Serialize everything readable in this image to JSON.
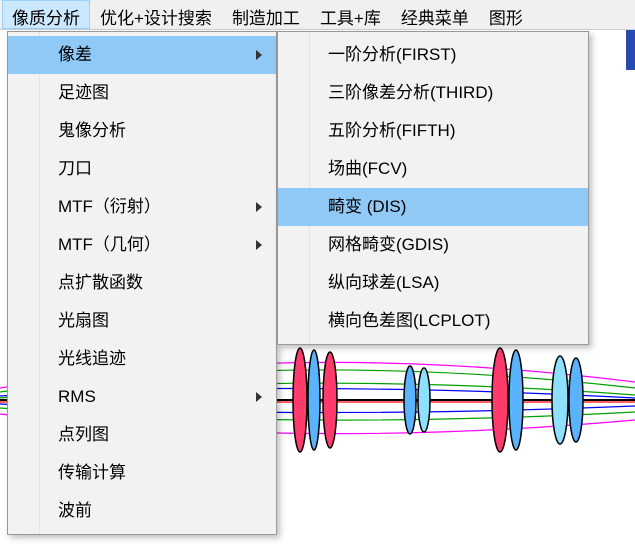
{
  "menubar": {
    "items": [
      {
        "label": "像质分析",
        "active": true
      },
      {
        "label": "优化+设计搜索",
        "active": false
      },
      {
        "label": "制造加工",
        "active": false
      },
      {
        "label": "工具+库",
        "active": false
      },
      {
        "label": "经典菜单",
        "active": false
      },
      {
        "label": "图形",
        "active": false
      }
    ]
  },
  "primary_menu": {
    "items": [
      {
        "label": "像差",
        "submenu": true,
        "highlight": true
      },
      {
        "label": "足迹图",
        "submenu": false,
        "highlight": false
      },
      {
        "label": "鬼像分析",
        "submenu": false,
        "highlight": false
      },
      {
        "label": "刀口",
        "submenu": false,
        "highlight": false
      },
      {
        "label": "MTF（衍射）",
        "submenu": true,
        "highlight": false
      },
      {
        "label": "MTF（几何）",
        "submenu": true,
        "highlight": false
      },
      {
        "label": "点扩散函数",
        "submenu": false,
        "highlight": false
      },
      {
        "label": "光扇图",
        "submenu": false,
        "highlight": false
      },
      {
        "label": "光线追迹",
        "submenu": false,
        "highlight": false
      },
      {
        "label": "RMS",
        "submenu": true,
        "highlight": false
      },
      {
        "label": "点列图",
        "submenu": false,
        "highlight": false
      },
      {
        "label": "传输计算",
        "submenu": false,
        "highlight": false
      },
      {
        "label": "波前",
        "submenu": false,
        "highlight": false
      }
    ]
  },
  "secondary_menu": {
    "items": [
      {
        "label": "一阶分析(FIRST)",
        "highlight": false
      },
      {
        "label": "三阶像差分析(THIRD)",
        "highlight": false
      },
      {
        "label": "五阶分析(FIFTH)",
        "highlight": false
      },
      {
        "label": "场曲(FCV)",
        "highlight": false
      },
      {
        "label": "畸变 (DIS)",
        "highlight": true
      },
      {
        "label": "网格畸变(GDIS)",
        "highlight": false
      },
      {
        "label": "纵向球差(LSA)",
        "highlight": false
      },
      {
        "label": "横向色差图(LCPLOT)",
        "highlight": false
      }
    ]
  },
  "colors": {
    "highlight": "#90c8f6",
    "menubar_active": "#cce8ff"
  }
}
